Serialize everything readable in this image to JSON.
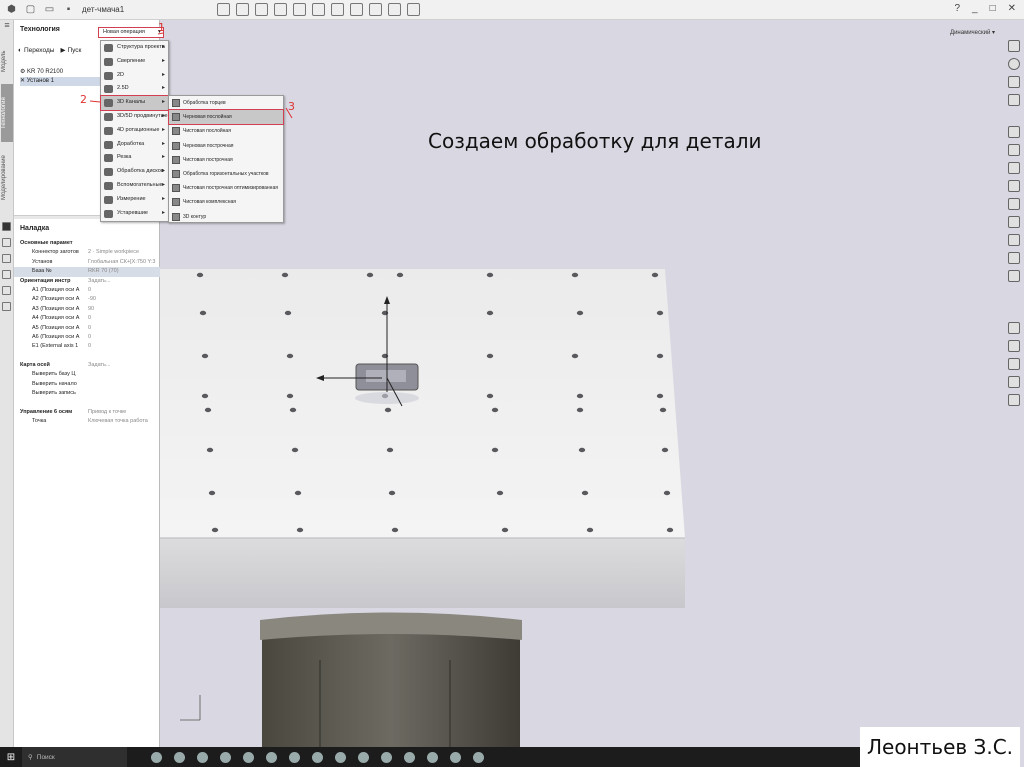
{
  "titlebar": {
    "document_name": "дет-чмача1",
    "window_controls": [
      "?",
      "_",
      "□",
      "✕"
    ]
  },
  "left_tabs": [
    "Модель",
    "Технология",
    "Моделирование"
  ],
  "panel": {
    "title": "Технология",
    "toolbar": {
      "transitions_label": "Переходы",
      "start_label": "Пуск"
    },
    "tree": [
      "KR 70 R2100",
      "Установ 1"
    ]
  },
  "new_operation": {
    "label": "Новая операция"
  },
  "operation_menu": {
    "items": [
      {
        "label": "Структура проекта",
        "has_submenu": true
      },
      {
        "label": "Сверление",
        "has_submenu": true
      },
      {
        "label": "2D",
        "has_submenu": true
      },
      {
        "label": "2.5D",
        "has_submenu": true
      },
      {
        "label": "3D Каналы",
        "has_submenu": true,
        "highlighted": true
      },
      {
        "label": "3D/5D продвинутые",
        "has_submenu": true
      },
      {
        "label": "4D ротационные",
        "has_submenu": true
      },
      {
        "label": "Доработка",
        "has_submenu": true
      },
      {
        "label": "Резка",
        "has_submenu": true
      },
      {
        "label": "Обработка дисков",
        "has_submenu": true
      },
      {
        "label": "Вспомогательные",
        "has_submenu": true
      },
      {
        "label": "Измерение",
        "has_submenu": true
      },
      {
        "label": "Устаревшие",
        "has_submenu": true
      }
    ]
  },
  "submenu": {
    "items": [
      {
        "label": "Обработка торцев"
      },
      {
        "label": "Черновая послойная",
        "highlighted": true
      },
      {
        "label": "Чистовая послойная"
      },
      {
        "label": "Черновая построчная"
      },
      {
        "label": "Чистовая построчная"
      },
      {
        "label": "Обработка горизонтальных участков"
      },
      {
        "label": "Чистовая построчная оптимизированная"
      },
      {
        "label": "Чистовая комплексная"
      },
      {
        "label": "3D контур"
      }
    ]
  },
  "annotations": {
    "one": "1",
    "two": "2",
    "three": "3"
  },
  "properties": {
    "title": "Наладка",
    "rows": [
      {
        "label": "Основные парамет",
        "value": "",
        "indent": 0,
        "bold": true
      },
      {
        "label": "Коннектор заготов",
        "value": "2 · Simple workpiece",
        "indent": 2
      },
      {
        "label": "Установ",
        "value": "Глобальная СК+[X:750 Y:3",
        "indent": 2
      },
      {
        "label": "База №",
        "value": "RKR 70 (70)",
        "indent": 2,
        "highlighted": true
      },
      {
        "label": "Ориентация инстр",
        "value": "Задать...",
        "indent": 0,
        "bold": true
      },
      {
        "label": "A1 (Позиция оси А",
        "value": "0",
        "indent": 2
      },
      {
        "label": "A2 (Позиция оси А",
        "value": "-90",
        "indent": 2
      },
      {
        "label": "A3 (Позиция оси А",
        "value": "90",
        "indent": 2
      },
      {
        "label": "A4 (Позиция оси А",
        "value": "0",
        "indent": 2
      },
      {
        "label": "A5 (Позиция оси А",
        "value": "0",
        "indent": 2
      },
      {
        "label": "A6 (Позиция оси А",
        "value": "0",
        "indent": 2
      },
      {
        "label": "E1 (External axis 1",
        "value": "0",
        "indent": 2
      },
      {
        "label": "",
        "value": "",
        "indent": 0
      },
      {
        "label": "Карта осей",
        "value": "Задать...",
        "indent": 0,
        "bold": true
      },
      {
        "label": "Выверить базу Ц",
        "value": "",
        "indent": 2
      },
      {
        "label": "Выверить начало",
        "value": "",
        "indent": 2
      },
      {
        "label": "Выверить запись",
        "value": "",
        "indent": 2
      },
      {
        "label": "",
        "value": "",
        "indent": 0
      },
      {
        "label": "Управление 6 осям",
        "value": "Привод к точке",
        "indent": 0,
        "bold": true
      },
      {
        "label": "Точка",
        "value": "Ключевая точка работа",
        "indent": 2
      }
    ]
  },
  "view_mode": "Динамический",
  "caption": "Создаем обработку для детали",
  "author": "Леонтьев З.С.",
  "taskbar": {
    "search_placeholder": "Поиск"
  }
}
